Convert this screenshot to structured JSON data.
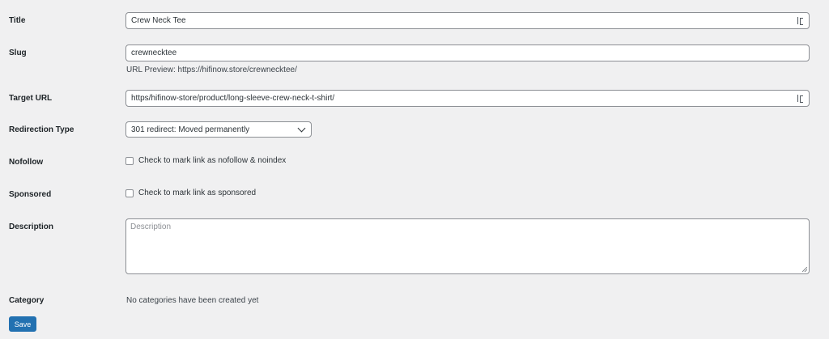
{
  "form": {
    "title": {
      "label": "Title",
      "value": "Crew Neck Tee"
    },
    "slug": {
      "label": "Slug",
      "value": "crewnecktee",
      "preview_label": "URL Preview:",
      "preview_url": "https://hifinow.store/crewnecktee/"
    },
    "target_url": {
      "label": "Target URL",
      "value": "https/hifinow-store/product/long-sleeve-crew-neck-t-shirt/"
    },
    "redirection_type": {
      "label": "Redirection Type",
      "selected": "301 redirect: Moved permanently"
    },
    "nofollow": {
      "label": "Nofollow",
      "checkbox_label": "Check to mark link as nofollow & noindex",
      "checked": false
    },
    "sponsored": {
      "label": "Sponsored",
      "checkbox_label": "Check to mark link as sponsored",
      "checked": false
    },
    "description": {
      "label": "Description",
      "placeholder": "Description",
      "value": ""
    },
    "category": {
      "label": "Category",
      "empty_text": "No categories have been created yet"
    },
    "save_label": "Save"
  },
  "colors": {
    "accent": "#2271b1",
    "background": "#f0f0f1",
    "border": "#8c8f94"
  }
}
